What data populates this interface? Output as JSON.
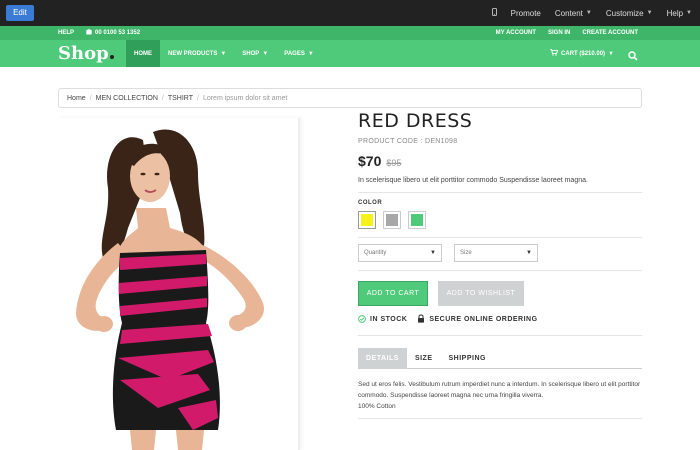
{
  "admin_bar": {
    "edit_label": "Edit",
    "items": [
      "Promote",
      "Content",
      "Customize",
      "Help"
    ]
  },
  "top_strip": {
    "help_label": "HELP",
    "phone": "00 0100 53 1352",
    "my_account": "MY ACCOUNT",
    "sign_in": "SIGN IN",
    "create_account": "CREATE ACCOUNT"
  },
  "nav": {
    "logo": "Shop",
    "items": [
      "HOME",
      "NEW PRODUCTS",
      "SHOP",
      "PAGES"
    ],
    "cart_label": "CART ($210.00)"
  },
  "breadcrumb": {
    "items": [
      "Home",
      "MEN COLLECTION",
      "TSHIRT"
    ],
    "current": "Lorem ipsum dolor sit amet"
  },
  "product": {
    "title": "RED DRESS",
    "code": "PRODUCT CODE : DEN1098",
    "price": "$70",
    "old_price": "$95",
    "description": "In scelerisque libero ut elit porttitor commodo Suspendisse laoreet magna.",
    "color_label": "COLOR",
    "colors": [
      "#f7f31a",
      "#a8a8a8",
      "#4fc97a"
    ],
    "quantity_placeholder": "Quantity",
    "size_placeholder": "Size",
    "add_to_cart": "ADD TO CART",
    "add_to_wishlist": "ADD TO WISHLIST",
    "in_stock": "IN STOCK",
    "secure": "SECURE ONLINE ORDERING",
    "tabs": [
      "DETAILS",
      "SIZE",
      "SHIPPING"
    ],
    "details_text": "Sed ut eros felis. Vestibulum rutrum imperdiet nunc a interdum. In scelerisque libero ut elit porttitor commodo. Suspendisse laoreet magna nec urna fringilla viverra.",
    "material": "100% Cotton"
  },
  "colors": {
    "brand_green": "#4fc97a",
    "dark_green": "#2f9f5a"
  }
}
